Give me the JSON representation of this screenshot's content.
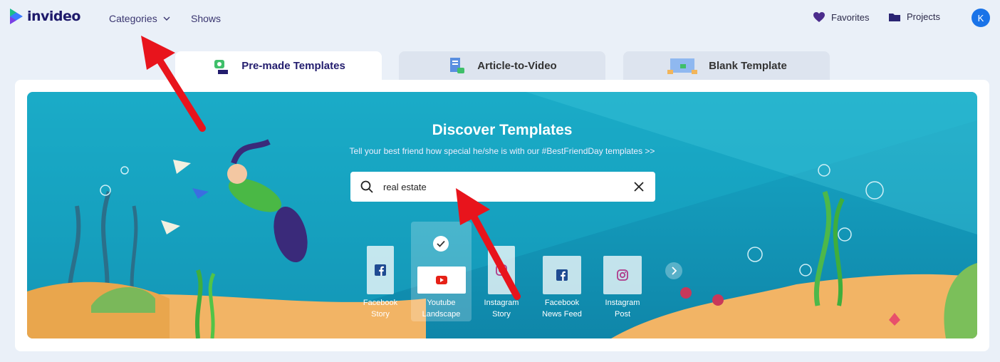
{
  "brand": {
    "name": "invideo"
  },
  "nav": {
    "categories_label": "Categories",
    "shows_label": "Shows",
    "favorites_label": "Favorites",
    "projects_label": "Projects",
    "avatar_initial": "K"
  },
  "tabs": [
    {
      "label": "Pre-made Templates",
      "active": true
    },
    {
      "label": "Article-to-Video",
      "active": false
    },
    {
      "label": "Blank Template",
      "active": false
    }
  ],
  "hero": {
    "title": "Discover Templates",
    "subtitle": "Tell your best friend how special he/she is with our #BestFriendDay templates >>"
  },
  "search": {
    "value": "real estate"
  },
  "formats": [
    {
      "line1": "Facebook",
      "line2": "Story",
      "icon": "facebook-icon",
      "selected": false
    },
    {
      "line1": "Youtube",
      "line2": "Landscape",
      "icon": "youtube-icon",
      "selected": true
    },
    {
      "line1": "Instagram",
      "line2": "Story",
      "icon": "instagram-icon",
      "selected": false
    },
    {
      "line1": "Facebook",
      "line2": "News Feed",
      "icon": "facebook-icon",
      "selected": false
    },
    {
      "line1": "Instagram",
      "line2": "Post",
      "icon": "instagram-icon",
      "selected": false
    }
  ],
  "colors": {
    "accent": "#1e1a6b",
    "hero_bg": "#149bbb",
    "annotation_arrow": "#e8141c"
  }
}
